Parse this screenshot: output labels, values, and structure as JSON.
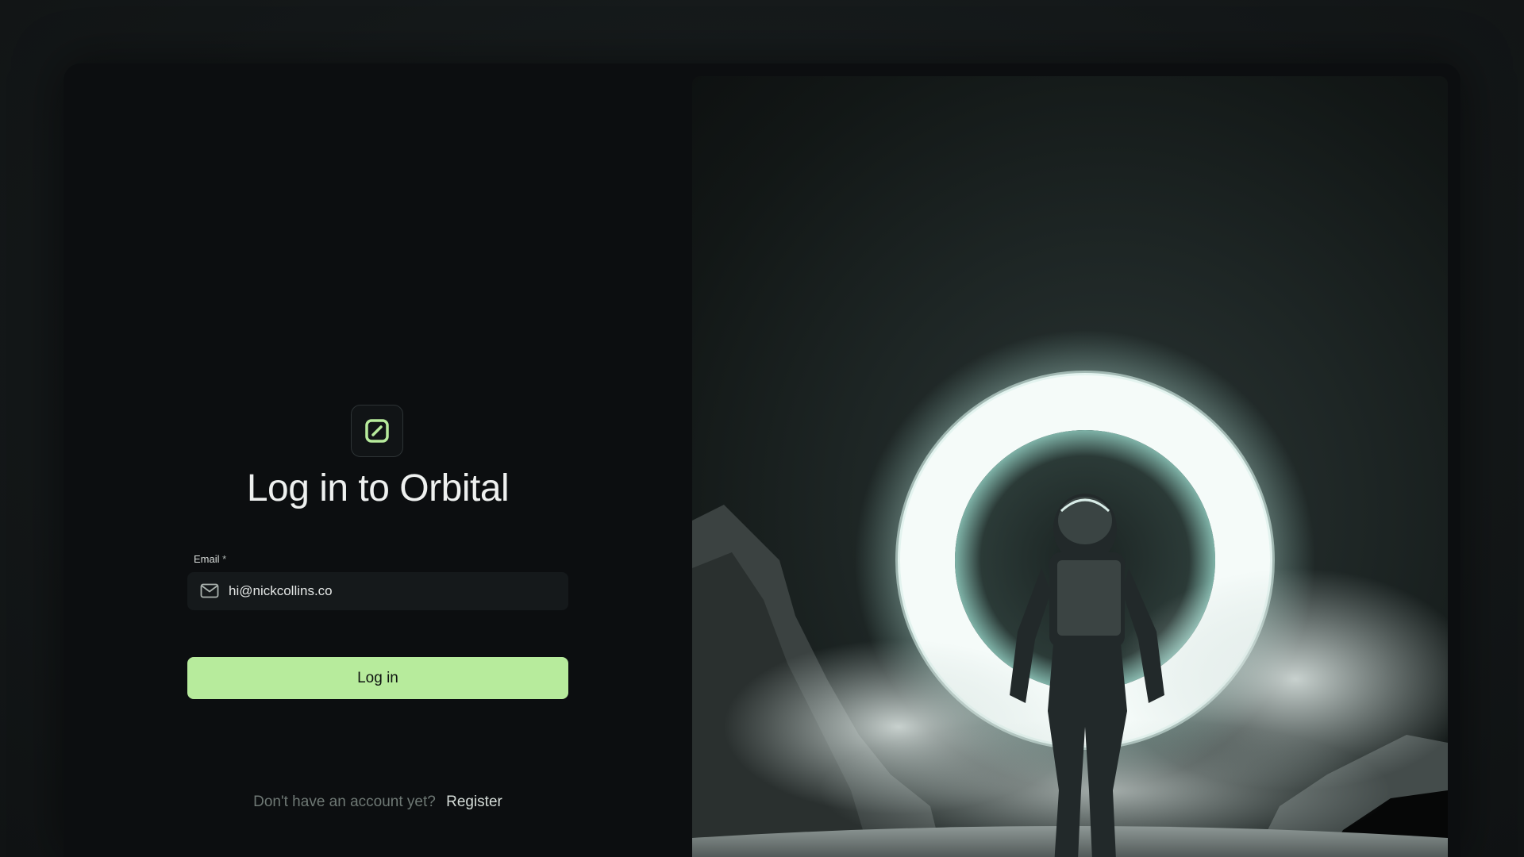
{
  "brand": {
    "logo_icon": "pencil-square-icon",
    "accent": "#b7eb9c"
  },
  "login": {
    "title": "Log in to Orbital",
    "email_label": "Email",
    "required_mark": "*",
    "email_value": "hi@nickcollins.co",
    "email_icon": "mail-icon",
    "submit_label": "Log in",
    "no_account_text": "Don't have an account yet?",
    "register_link": "Register"
  },
  "hero_image": {
    "subject": "astronaut-before-glowing-ring"
  }
}
